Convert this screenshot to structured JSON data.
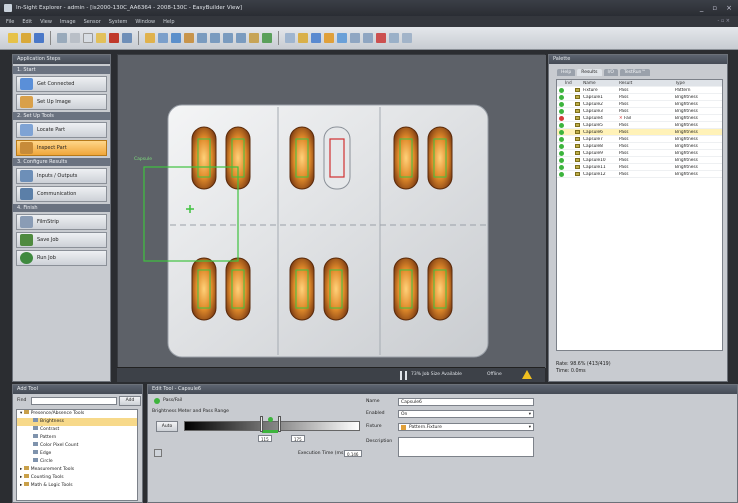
{
  "window": {
    "title": "In-Sight Explorer - admin - [is2000-130C_AA6364 - 2008-130C - EasyBuilder View]",
    "controls": [
      "_",
      "▫",
      "×"
    ]
  },
  "menu": {
    "items": [
      "File",
      "Edit",
      "View",
      "Image",
      "Sensor",
      "System",
      "Window",
      "Help"
    ],
    "right": "- ▫ ×"
  },
  "left_panel": {
    "title": "Application Steps",
    "sections": [
      {
        "label": "1. Start",
        "steps": [
          {
            "label": "Get Connected",
            "icon_color": "#5a8fd8"
          },
          {
            "label": "Set Up Image",
            "icon_color": "#d9a04a"
          }
        ]
      },
      {
        "label": "2. Set Up Tools",
        "steps": [
          {
            "label": "Locate Part",
            "icon_color": "#7fa3d4"
          },
          {
            "label": "Inspect Part",
            "icon_color": "#c78b39",
            "active": true
          }
        ]
      },
      {
        "label": "3. Configure Results",
        "steps": [
          {
            "label": "Inputs / Outputs",
            "icon_color": "#6d8fb8"
          },
          {
            "label": "Communication",
            "icon_color": "#5b7fa8"
          }
        ]
      },
      {
        "label": "4. Finish",
        "steps": [
          {
            "label": "FilmStrip",
            "icon_color": "#8a9cb5"
          },
          {
            "label": "Save Job",
            "icon_color": "#4f8a3f"
          },
          {
            "label": "Run Job",
            "icon_color": "#3f8a3f"
          }
        ]
      }
    ]
  },
  "image": {
    "overlay_label": "Capsule",
    "status": {
      "text": "73% Job Size Available",
      "mode": "Offline",
      "warning_icon": "warning-icon"
    }
  },
  "right_panel": {
    "title": "Palette",
    "tabs": [
      "Help",
      "Results",
      "I/O",
      "TestRun™"
    ],
    "selected_tab": "Results",
    "columns": [
      "Ind",
      "Name",
      "Result",
      "Type"
    ],
    "rows": [
      {
        "status": "pass",
        "name": "Fixture",
        "result": "Pass",
        "type": "Pattern"
      },
      {
        "status": "pass",
        "name": "Capsule1",
        "result": "Pass",
        "type": "Brightness"
      },
      {
        "status": "pass",
        "name": "Capsule2",
        "result": "Pass",
        "type": "Brightness"
      },
      {
        "status": "pass",
        "name": "Capsule3",
        "result": "Pass",
        "type": "Brightness"
      },
      {
        "status": "fail",
        "name": "Capsule4",
        "result": "Fail",
        "type": "Brightness"
      },
      {
        "status": "pass",
        "name": "Capsule5",
        "result": "Pass",
        "type": "Brightness"
      },
      {
        "status": "pass",
        "name": "Capsule6",
        "result": "Pass",
        "type": "Brightness",
        "highlight": true
      },
      {
        "status": "pass",
        "name": "Capsule7",
        "result": "Pass",
        "type": "Brightness"
      },
      {
        "status": "pass",
        "name": "Capsule8",
        "result": "Pass",
        "type": "Brightness"
      },
      {
        "status": "pass",
        "name": "Capsule9",
        "result": "Pass",
        "type": "Brightness"
      },
      {
        "status": "pass",
        "name": "Capsule10",
        "result": "Pass",
        "type": "Brightness"
      },
      {
        "status": "pass",
        "name": "Capsule11",
        "result": "Pass",
        "type": "Brightness"
      },
      {
        "status": "pass",
        "name": "Capsule12",
        "result": "Pass",
        "type": "Brightness"
      }
    ],
    "stats": {
      "rate": "Rate: 98.6% (413/419)",
      "time": "Time: 0.0ms"
    }
  },
  "add_tool": {
    "title": "Add Tool",
    "find_label": "Find",
    "add_button": "Add",
    "tree": [
      {
        "label": "Presence/Absence Tools",
        "level": 0,
        "expander": "▾"
      },
      {
        "label": "Brightness",
        "level": 1,
        "selected": true
      },
      {
        "label": "Contrast",
        "level": 1
      },
      {
        "label": "Pattern",
        "level": 1
      },
      {
        "label": "Color Pixel Count",
        "level": 1
      },
      {
        "label": "Edge",
        "level": 1
      },
      {
        "label": "Circle",
        "level": 1
      },
      {
        "label": "Measurement Tools",
        "level": 0,
        "expander": "▸"
      },
      {
        "label": "Counting Tools",
        "level": 0,
        "expander": "▸"
      },
      {
        "label": "Math & Logic Tools",
        "level": 0,
        "expander": "▸"
      }
    ]
  },
  "edit_tool": {
    "title": "Edit Tool - Capsule6",
    "pass_fail": "Pass/Fail",
    "section_label": "Brightness Meter and Pass Range",
    "auto_button": "Auto",
    "range_low": "115",
    "range_high": "175",
    "exec_label": "Execution Time (ms):",
    "exec_value": "0.146",
    "fields": {
      "name_label": "Name",
      "name_value": "Capsule6",
      "enabled_label": "Enabled",
      "enabled_value": "On",
      "fixture_label": "Fixture",
      "fixture_value": "Pattern.Fixture",
      "description_label": "Description",
      "description_value": ""
    }
  },
  "colors": {
    "accent": "#f0a63a",
    "pass": "#3db43d",
    "fail": "#d63a3a"
  }
}
